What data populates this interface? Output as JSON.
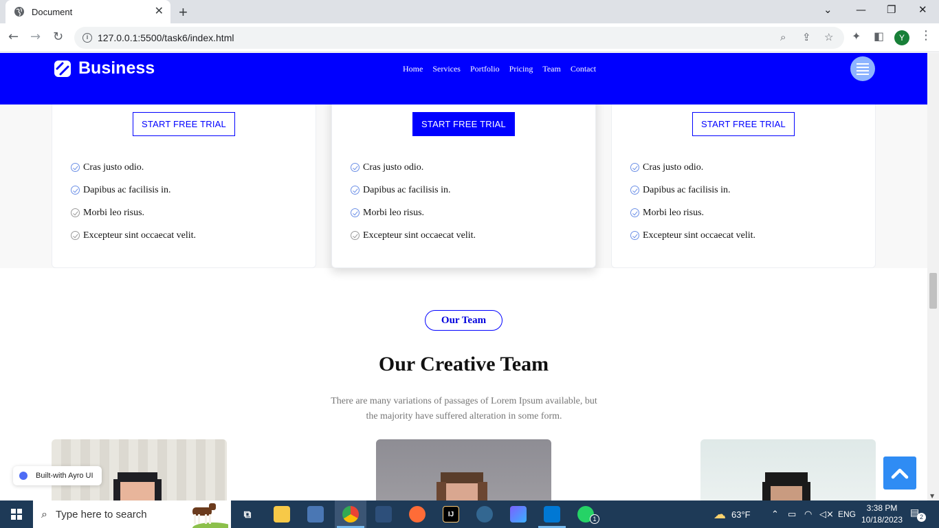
{
  "browser": {
    "tab_title": "Document",
    "tab_close": "✕",
    "new_tab": "+",
    "url": "127.0.0.1:5500/task6/index.html",
    "profile_initial": "Y",
    "icons": [
      "globe-icon",
      "back-icon",
      "forward-icon",
      "reload-icon",
      "info-icon",
      "zoom-icon",
      "share-icon",
      "star-icon",
      "extensions-icon",
      "sidepanel-icon",
      "menu-icon",
      "minimize-icon",
      "restore-icon",
      "close-icon",
      "tab-list-icon"
    ]
  },
  "site": {
    "brand": "Business",
    "nav": [
      "Home",
      "Services",
      "Portfolio",
      "Pricing",
      "Team",
      "Contact"
    ],
    "accent": "#0000ff"
  },
  "pricing": {
    "cta": "START FREE TRIAL",
    "features": [
      "Cras justo odio.",
      "Dapibus ac facilisis in.",
      "Morbi leo risus.",
      "Excepteur sint occaecat velit."
    ],
    "featured_card": 2
  },
  "team": {
    "pill": "Our Team",
    "title": "Our Creative Team",
    "description_line1": "There are many variations of passages of Lorem Ipsum available, but",
    "description_line2": "the majority have suffered alteration in some form."
  },
  "widgets": {
    "ayro_badge": "Built-with Ayro UI"
  },
  "taskbar": {
    "search_placeholder": "Type here to search",
    "weather": "63°F",
    "language": "ENG",
    "time": "3:38 PM",
    "date": "10/18/2023",
    "notification_count": "2",
    "whatsapp_badge": "1"
  }
}
